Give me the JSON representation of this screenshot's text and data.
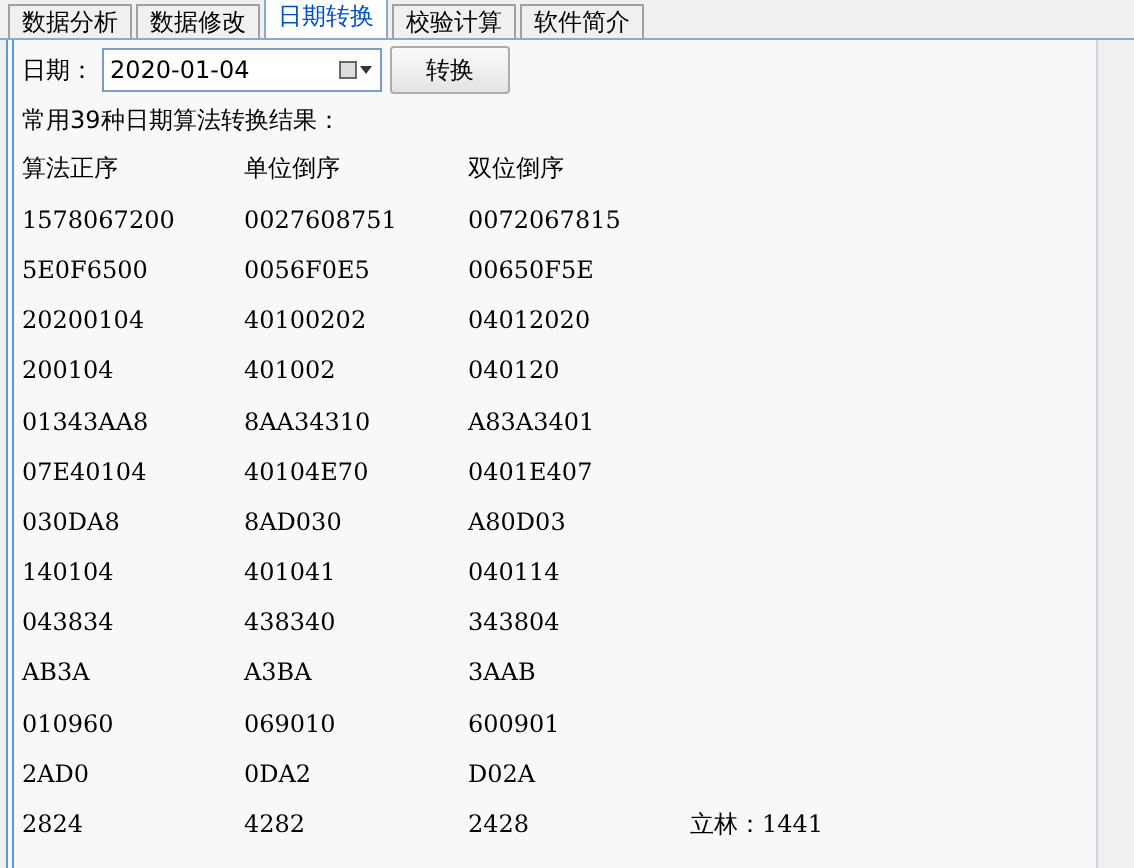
{
  "tabs": [
    {
      "label": "数据分析",
      "selected": false
    },
    {
      "label": "数据修改",
      "selected": false
    },
    {
      "label": "日期转换",
      "selected": true
    },
    {
      "label": "校验计算",
      "selected": false
    },
    {
      "label": "软件简介",
      "selected": false
    }
  ],
  "date_bar": {
    "label": "日期：",
    "value": "2020-01-04",
    "button": "转换"
  },
  "result": {
    "heading": "常用39种日期算法转换结果：",
    "columns": [
      "算法正序",
      "单位倒序",
      "双位倒序"
    ],
    "rows": [
      [
        "1578067200",
        "0027608751",
        "0072067815"
      ],
      [
        "5E0F6500",
        "0056F0E5",
        "00650F5E"
      ],
      [
        "20200104",
        "40100202",
        "04012020"
      ],
      [
        "200104",
        "401002",
        "040120"
      ],
      [
        "01343AA8",
        "8AA34310",
        "A83A3401"
      ],
      [
        "07E40104",
        "40104E70",
        "0401E407"
      ],
      [
        "030DA8",
        "8AD030",
        "A80D03"
      ],
      [
        "140104",
        "401041",
        "040114"
      ],
      [
        "043834",
        "438340",
        "343804"
      ],
      [
        "AB3A",
        "A3BA",
        "3AAB"
      ],
      [
        "010960",
        "069010",
        "600901"
      ],
      [
        "2AD0",
        "0DA2",
        "D02A"
      ],
      [
        "2824",
        "4282",
        "2428",
        "立林：1441"
      ]
    ]
  }
}
